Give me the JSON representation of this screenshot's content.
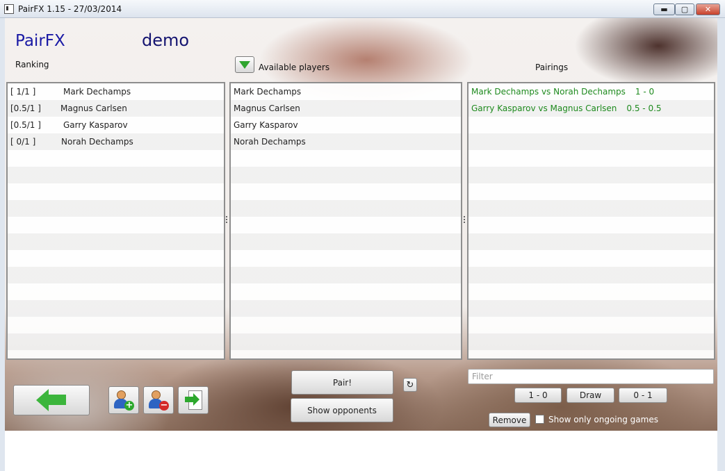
{
  "window": {
    "title": "PairFX 1.15 - 27/03/2014",
    "controls": {
      "minimize": "▬",
      "maximize": "▢",
      "close": "✕"
    }
  },
  "header": {
    "app_name": "PairFX",
    "tournament": "demo",
    "ranking_label": "Ranking",
    "available_label": "Available players",
    "pairings_label": "Pairings"
  },
  "ranking": [
    {
      "score": "[ 1/1   ]",
      "name": "Mark Dechamps"
    },
    {
      "score": "[0.5/1  ]",
      "name": "Magnus Carlsen"
    },
    {
      "score": "[0.5/1  ]",
      "name": "Garry Kasparov"
    },
    {
      "score": "[ 0/1   ]",
      "name": "Norah Dechamps"
    }
  ],
  "available_players": [
    "Mark Dechamps",
    "Magnus Carlsen",
    "Garry Kasparov",
    "Norah Dechamps"
  ],
  "pairings": [
    {
      "match": "Mark Dechamps vs Norah Dechamps",
      "result": "1 - 0"
    },
    {
      "match": "Garry Kasparov vs Magnus Carlsen",
      "result": "0.5 - 0.5"
    }
  ],
  "controls": {
    "pair_label": "Pair!",
    "show_opponents_label": "Show opponents",
    "refresh_glyph": "↻",
    "filter_placeholder": "Filter",
    "win_label": "1 - 0",
    "draw_label": "Draw",
    "loss_label": "0 - 1",
    "remove_label": "Remove",
    "ongoing_label": "Show only ongoing games"
  },
  "icons": {
    "back": "back-arrow-icon",
    "add_player": "add-player-icon",
    "remove_player": "remove-player-icon",
    "export": "export-icon"
  },
  "colors": {
    "brand": "#1a1aa5",
    "pairing_text": "#1e8a1e",
    "accent_green": "#3cb53c"
  }
}
